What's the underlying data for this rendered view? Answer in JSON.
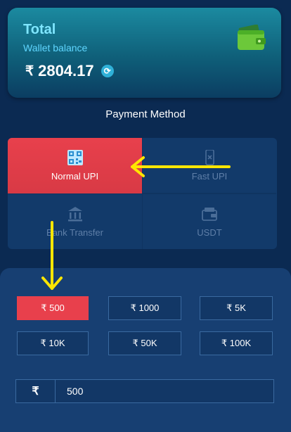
{
  "wallet": {
    "title": "Total",
    "subtitle": "Wallet balance",
    "currency": "₹",
    "balance": "2804.17",
    "icon": "wallet-icon",
    "refresh_icon": "refresh-icon"
  },
  "payment": {
    "heading": "Payment Method",
    "methods": [
      {
        "label": "Normal UPI",
        "icon": "qr-code-icon",
        "active": true
      },
      {
        "label": "Fast UPI",
        "icon": "phone-scan-icon",
        "active": false
      },
      {
        "label": "Bank Transfer",
        "icon": "bank-icon",
        "active": false
      },
      {
        "label": "USDT",
        "icon": "wallet-card-icon",
        "active": false
      }
    ]
  },
  "amounts": {
    "options": [
      "₹ 500",
      "₹ 1000",
      "₹ 5K",
      "₹ 10K",
      "₹ 50K",
      "₹ 100K"
    ],
    "selected": "₹ 500"
  },
  "amount_input": {
    "currency": "₹",
    "value": "500"
  },
  "colors": {
    "background": "#0b2a52",
    "accent_red": "#e8404c",
    "annotation_arrow": "#ffe600"
  }
}
